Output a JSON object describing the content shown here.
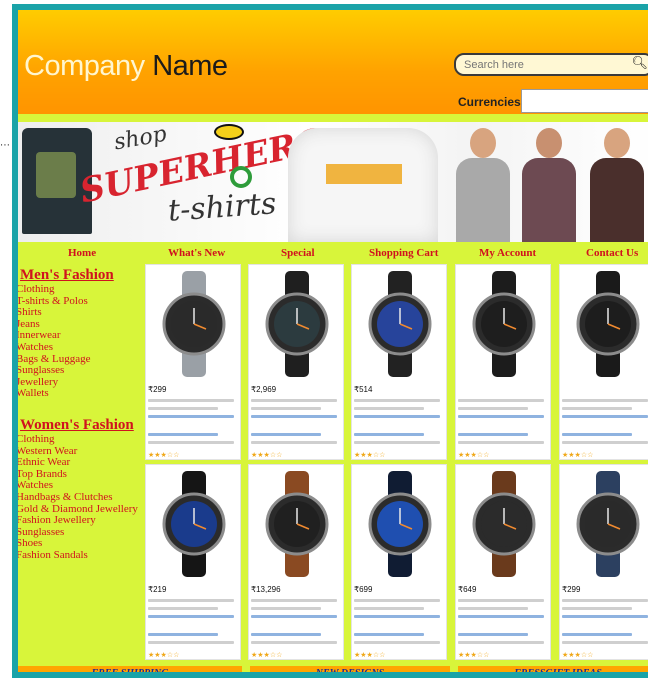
{
  "header": {
    "logo_word1": "Company",
    "logo_word2": "Name",
    "search_placeholder": "Search here",
    "currencies_label": "Currencies",
    "currencies_value": ""
  },
  "banner": {
    "shop": "shop",
    "superhero": "SUPERHERO",
    "tshirts": "t-shirts"
  },
  "nav": {
    "items": [
      "Home",
      "What's New",
      "Special",
      "Shopping Cart",
      "My Account",
      "Contact Us"
    ]
  },
  "sidebar": {
    "mens_title": "Men's Fashion",
    "mens": [
      "Clothing",
      "T-shirts & Polos",
      "Shirts",
      "Jeans",
      "Innerwear",
      "Watches",
      "Bags & Luggage",
      "Sunglasses",
      "Jewellery",
      "Wallets"
    ],
    "womens_title": "Women's Fashion",
    "womens": [
      "Clothing",
      "Western Wear",
      "Ethnic Wear",
      "Top Brands",
      "Watches",
      "Handbags & Clutches",
      "Gold & Diamond Jewellery",
      "Fashion Jewellery",
      "Sunglasses",
      "Shoes",
      "Fashion Sandals"
    ]
  },
  "products": [
    {
      "price": "₹299",
      "strap": "#9aa0a6",
      "face": "#2a2a2a"
    },
    {
      "price": "₹2,969",
      "strap": "#1f1f1f",
      "face": "#2c3b3f"
    },
    {
      "price": "₹514",
      "strap": "#222222",
      "face": "#27449b"
    },
    {
      "price": "",
      "strap": "#1c1c1c",
      "face": "#1e1e1e"
    },
    {
      "price": "",
      "strap": "#1a1a1a",
      "face": "#1d1d1d"
    },
    {
      "price": "₹219",
      "strap": "#151515",
      "face": "#1a3b8c"
    },
    {
      "price": "₹13,296",
      "strap": "#8a4a22",
      "face": "#202020"
    },
    {
      "price": "₹699",
      "strap": "#101c33",
      "face": "#1f4fb0"
    },
    {
      "price": "₹649",
      "strap": "#6a3a1c",
      "face": "#2b2b2b"
    },
    {
      "price": "₹299",
      "strap": "#2c4060",
      "face": "#2a2a2a"
    }
  ],
  "footer": {
    "items": [
      "FREE SHIPPING",
      "NEW DESIGNS",
      "FRESSGIFT IDEAS"
    ]
  },
  "colors": {
    "frame": "#1aa3a8",
    "background": "#d8f53a",
    "header": "#ffb300",
    "link": "#d0121e",
    "footer_band": "#ffa500"
  }
}
